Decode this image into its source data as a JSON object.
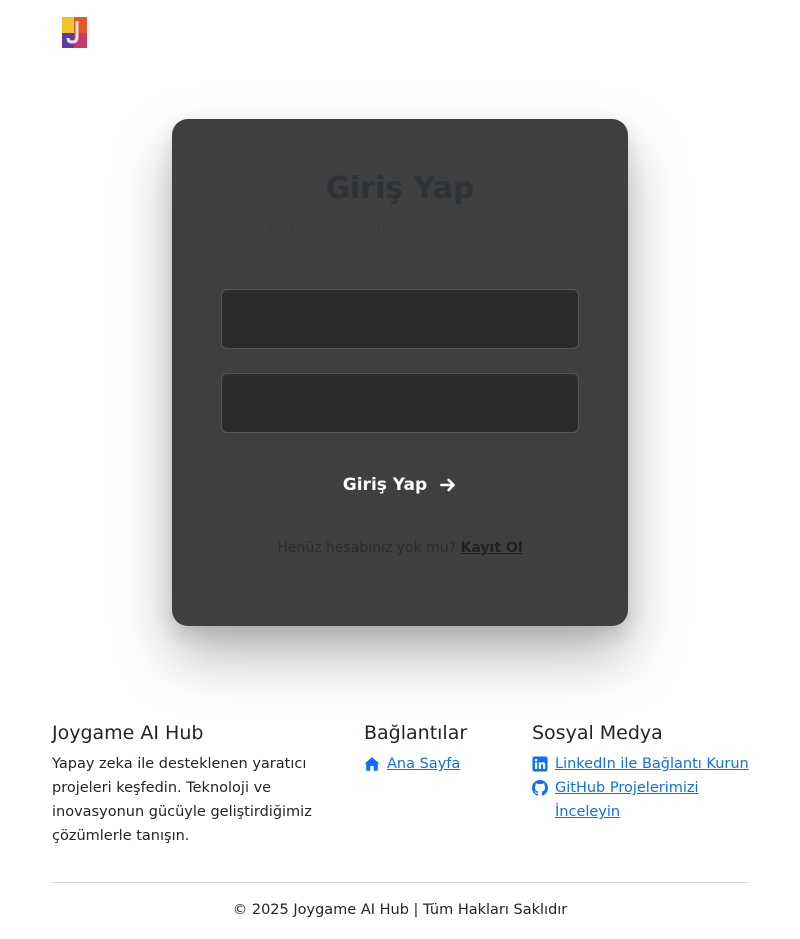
{
  "login": {
    "title": "Giriş Yap",
    "subtitle": "Portföyümü keşfetmek için giriş yapın",
    "username_placeholder": "",
    "password_placeholder": "",
    "submit_label": "Giriş Yap",
    "signup_prompt": "Henüz hesabınız yok mu?",
    "signup_link": "Kayıt Ol"
  },
  "footer": {
    "brand": {
      "title": "Joygame AI Hub",
      "description": "Yapay zeka ile desteklenen yaratıcı projeleri keşfedin. Teknoloji ve inovasyonun gücüyle geliştirdiğimiz çözümlerle tanışın."
    },
    "links": {
      "title": "Bağlantılar",
      "home": "Ana Sayfa"
    },
    "social": {
      "title": "Sosyal Medya",
      "linkedin": "LinkedIn ile Bağlantı Kurun",
      "github": "GitHub Projelerimizi İnceleyin"
    },
    "copyright": "© 2025 Joygame AI Hub | Tüm Hakları Saklıdır"
  },
  "icons": {
    "logo": "joygame-logo",
    "submit": "arrow-right-icon",
    "home": "house-icon",
    "linkedin": "linkedin-icon",
    "github": "github-icon"
  },
  "colors": {
    "card": "#3f3f3f",
    "link": "#0d6efd"
  }
}
